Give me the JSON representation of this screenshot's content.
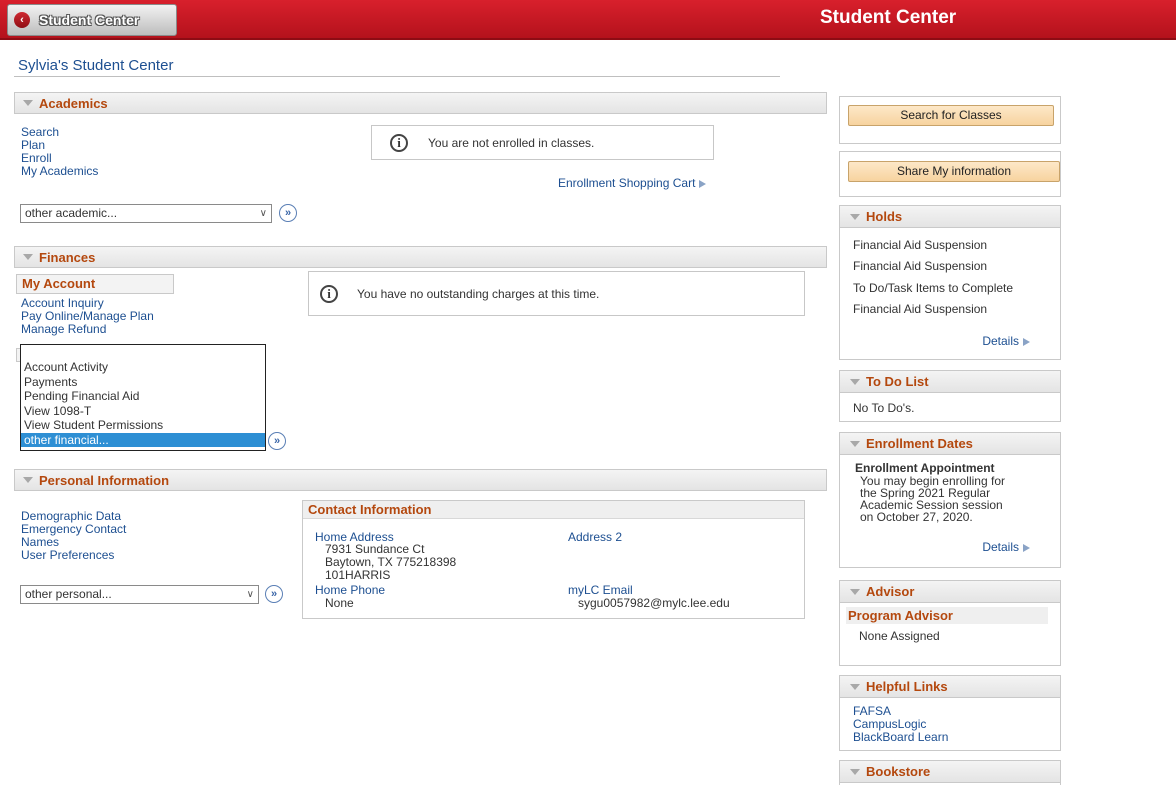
{
  "header": {
    "back_label": "Student Center",
    "back_icon": "chevron-left-icon",
    "title": "Student Center"
  },
  "page_heading": "Sylvia's Student Center",
  "academics": {
    "title": "Academics",
    "links": [
      "Search",
      "Plan",
      "Enroll",
      "My Academics"
    ],
    "message": "You are not enrolled in classes.",
    "cart_link": "Enrollment Shopping Cart",
    "select_value": "other academic..."
  },
  "finances": {
    "title": "Finances",
    "tab": "My Account",
    "links": [
      "Account Inquiry",
      "Pay Online/Manage Plan",
      "Manage Refund"
    ],
    "message": "You have no outstanding charges at this time.",
    "options": [
      "Account Activity",
      "Payments",
      "Pending Financial Aid",
      "View 1098-T",
      "View Student Permissions",
      "other financial..."
    ],
    "selected_option": "other financial..."
  },
  "personal": {
    "title": "Personal Information",
    "links": [
      "Demographic Data",
      "Emergency Contact",
      "Names",
      "User Preferences"
    ],
    "select_value": "other personal...",
    "contact": {
      "title": "Contact Information",
      "home_address_label": "Home Address",
      "home_address_lines": [
        "7931 Sundance Ct",
        "Baytown, TX 775218398",
        "101HARRIS"
      ],
      "address2_label": "Address 2",
      "home_phone_label": "Home Phone",
      "home_phone_value": "None",
      "email_label": "myLC Email",
      "email_value": "sygu0057982@mylc.lee.edu"
    }
  },
  "sidebar": {
    "search_button": "Search for Classes",
    "share_button": "Share My information",
    "holds": {
      "title": "Holds",
      "items": [
        "Financial Aid Suspension",
        "Financial Aid Suspension",
        "To Do/Task Items to Complete",
        "Financial Aid Suspension"
      ],
      "details": "Details"
    },
    "todo": {
      "title": "To Do List",
      "text": "No To Do's."
    },
    "enrollment_dates": {
      "title": "Enrollment Dates",
      "subtitle": "Enrollment Appointment",
      "lines": [
        "You may begin enrolling for",
        "the Spring 2021 Regular",
        "Academic Session session",
        "on October 27, 2020."
      ],
      "details": "Details"
    },
    "advisor": {
      "title": "Advisor",
      "subtitle": "Program Advisor",
      "text": "None Assigned"
    },
    "helpful_links": {
      "title": "Helpful Links",
      "items": [
        "FAFSA",
        "CampusLogic",
        "BlackBoard Learn"
      ]
    },
    "bookstore": {
      "title": "Bookstore"
    }
  },
  "colors": {
    "banner_red": "#c41822",
    "link_blue": "#1d4f91",
    "section_orange": "#b4480e",
    "button_peach": "#f9d9a8",
    "listbox_highlight": "#2e8fd4"
  }
}
